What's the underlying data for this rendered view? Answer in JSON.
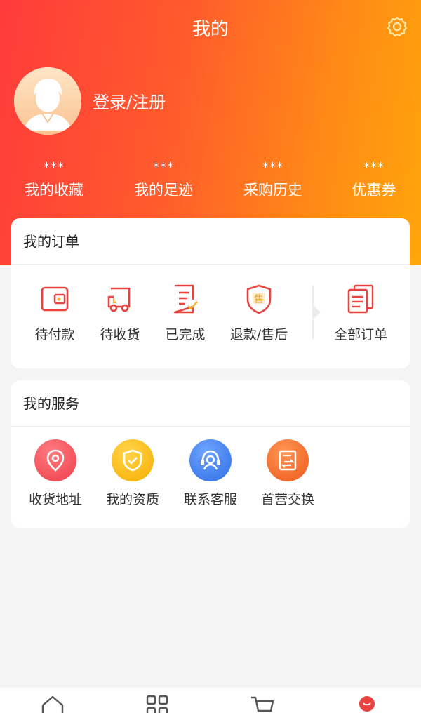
{
  "header": {
    "title": "我的",
    "login_label": "登录/注册",
    "icons": {
      "settings": "gear-icon",
      "avatar": "user-avatar"
    }
  },
  "stats": [
    {
      "value": "***",
      "label": "我的收藏"
    },
    {
      "value": "***",
      "label": "我的足迹"
    },
    {
      "value": "***",
      "label": "采购历史"
    },
    {
      "value": "***",
      "label": "优惠券"
    }
  ],
  "orders": {
    "title": "我的订单",
    "items": [
      {
        "label": "待付款",
        "icon": "wallet-icon"
      },
      {
        "label": "待收货",
        "icon": "truck-icon"
      },
      {
        "label": "已完成",
        "icon": "checked-doc-icon"
      },
      {
        "label": "退款/售后",
        "icon": "shield-sale-icon"
      },
      {
        "label": "全部订单",
        "icon": "documents-icon"
      }
    ]
  },
  "services": {
    "title": "我的服务",
    "items": [
      {
        "label": "收货地址",
        "icon": "location-pin-icon",
        "color": "#f0535c"
      },
      {
        "label": "我的资质",
        "icon": "shield-check-icon",
        "color": "#fbb800"
      },
      {
        "label": "联系客服",
        "icon": "headset-icon",
        "color": "#3d7ff0"
      },
      {
        "label": "首营交换",
        "icon": "exchange-doc-icon",
        "color": "#f36a2c"
      }
    ]
  },
  "tabbar": {
    "items": [
      {
        "icon": "home-icon"
      },
      {
        "icon": "category-grid-icon"
      },
      {
        "icon": "cart-icon"
      },
      {
        "icon": "profile-icon",
        "active": true
      }
    ]
  },
  "colors": {
    "gradient_start": "#ff3b3b",
    "gradient_end": "#ffa60a",
    "icon_red": "#e8433f"
  }
}
